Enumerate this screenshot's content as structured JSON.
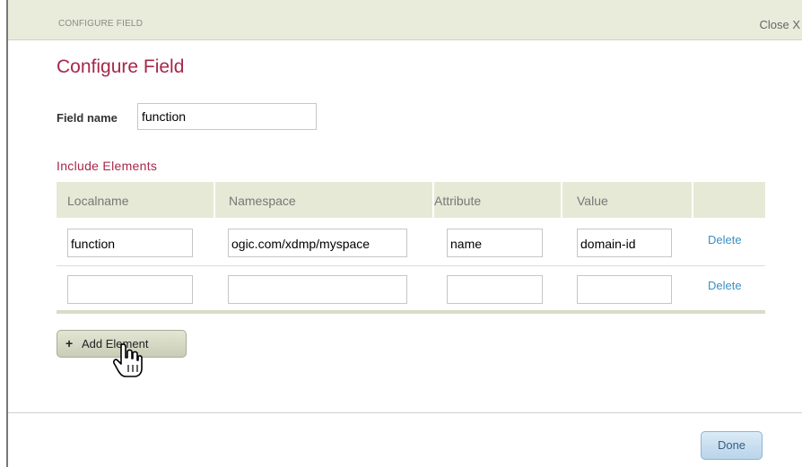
{
  "titlebar": {
    "text": "CONFIGURE FIELD",
    "close_label": "Close X"
  },
  "dialog": {
    "title": "Configure Field"
  },
  "field": {
    "label": "Field name",
    "value": "function"
  },
  "section": {
    "title": "Include Elements"
  },
  "table": {
    "headers": [
      "Localname",
      "Namespace",
      "Attribute",
      "Value"
    ],
    "rows": [
      {
        "localname": "function",
        "namespace": "ogic.com/xdmp/myspace",
        "attribute": "name",
        "value": "domain-id",
        "delete": "Delete"
      },
      {
        "localname": "",
        "namespace": "",
        "attribute": "",
        "value": "",
        "delete": "Delete"
      }
    ]
  },
  "buttons": {
    "add_element": "Add Element",
    "add_icon": "+",
    "done": "Done"
  },
  "colors": {
    "accent": "#a8274a",
    "link": "#3a8fc7",
    "header_bg": "#e9ecda"
  }
}
